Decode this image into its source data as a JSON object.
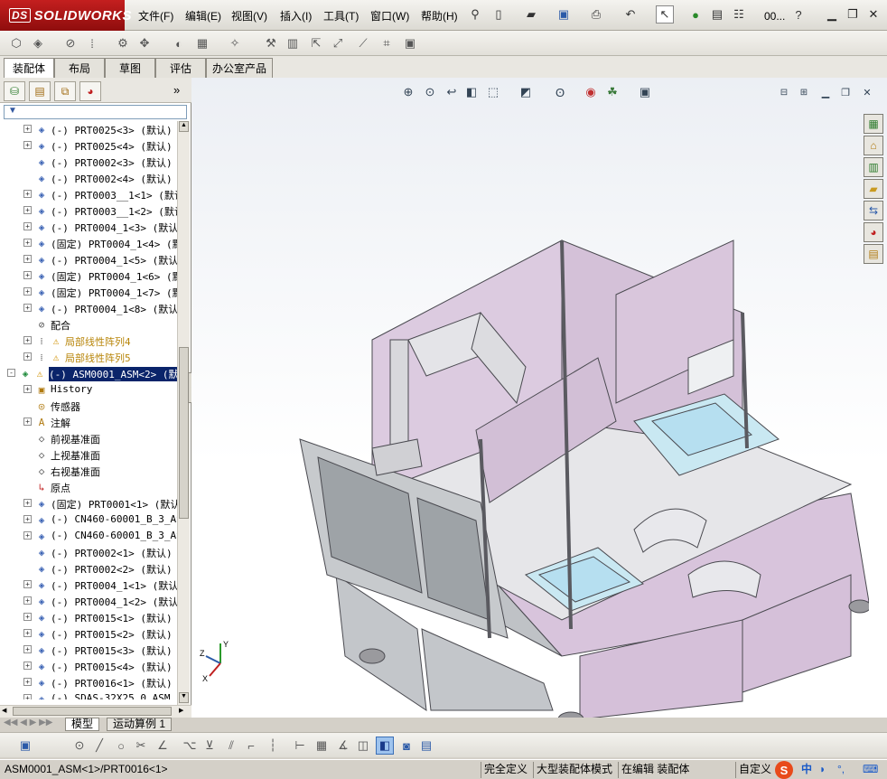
{
  "app": {
    "logo_text": "SOLIDWORKS",
    "logo_prefix": "DS"
  },
  "menu": [
    "文件(F)",
    "编辑(E)",
    "视图(V)",
    "插入(I)",
    "工具(T)",
    "窗口(W)",
    "帮助(H)"
  ],
  "quickbar": {
    "overflow_label": "00...",
    "help_label": "?"
  },
  "command_tabs": [
    {
      "label": "装配体",
      "active": true
    },
    {
      "label": "布局"
    },
    {
      "label": "草图"
    },
    {
      "label": "评估"
    },
    {
      "label": "办公室产品"
    }
  ],
  "left_pane": {
    "filter_symbol": "▼",
    "collapse_label": "»"
  },
  "tree": [
    {
      "exp": "+",
      "indent": 1,
      "icon": "part",
      "text": "(-) PRT0025<3> (默认)"
    },
    {
      "exp": "+",
      "indent": 1,
      "icon": "part",
      "text": "(-) PRT0025<4> (默认)"
    },
    {
      "exp": "",
      "indent": 1,
      "icon": "part",
      "text": "(-) PRT0002<3> (默认)"
    },
    {
      "exp": "",
      "indent": 1,
      "icon": "part",
      "text": "(-) PRT0002<4> (默认)"
    },
    {
      "exp": "+",
      "indent": 1,
      "icon": "part",
      "text": "(-) PRT0003__1<1> (默认"
    },
    {
      "exp": "+",
      "indent": 1,
      "icon": "part",
      "text": "(-) PRT0003__1<2> (默认"
    },
    {
      "exp": "+",
      "indent": 1,
      "icon": "part",
      "text": "(-) PRT0004_1<3> (默认"
    },
    {
      "exp": "+",
      "indent": 1,
      "icon": "part",
      "text": "(固定) PRT0004_1<4> (默"
    },
    {
      "exp": "+",
      "indent": 1,
      "icon": "part",
      "text": "(-) PRT0004_1<5> (默认"
    },
    {
      "exp": "+",
      "indent": 1,
      "icon": "part",
      "text": "(固定) PRT0004_1<6> (默"
    },
    {
      "exp": "+",
      "indent": 1,
      "icon": "part",
      "text": "(固定) PRT0004_1<7> (默"
    },
    {
      "exp": "+",
      "indent": 1,
      "icon": "part",
      "text": "(-) PRT0004_1<8> (默认"
    },
    {
      "exp": "",
      "indent": 1,
      "icon": "mate",
      "text": "配合"
    },
    {
      "exp": "+",
      "indent": 1,
      "icon": "pattern-warn",
      "text": "局部线性阵列4",
      "warn": true
    },
    {
      "exp": "+",
      "indent": 1,
      "icon": "pattern-warn",
      "text": "局部线性阵列5",
      "warn": true
    },
    {
      "exp": "-",
      "indent": 0,
      "icon": "asm-warn",
      "text": "(-) ASM0001_ASM<2> (默认",
      "selected": true
    },
    {
      "exp": "+",
      "indent": 1,
      "icon": "history",
      "text": "History"
    },
    {
      "exp": "",
      "indent": 1,
      "icon": "sensor",
      "text": "传感器"
    },
    {
      "exp": "+",
      "indent": 1,
      "icon": "annot",
      "text": "注解"
    },
    {
      "exp": "",
      "indent": 1,
      "icon": "plane",
      "text": "前视基准面"
    },
    {
      "exp": "",
      "indent": 1,
      "icon": "plane",
      "text": "上视基准面"
    },
    {
      "exp": "",
      "indent": 1,
      "icon": "plane",
      "text": "右视基准面"
    },
    {
      "exp": "",
      "indent": 1,
      "icon": "origin",
      "text": "原点"
    },
    {
      "exp": "+",
      "indent": 1,
      "icon": "part",
      "text": "(固定) PRT0001<1> (默认"
    },
    {
      "exp": "+",
      "indent": 1,
      "icon": "part",
      "text": "(-) CN460-60001_B_3_AS"
    },
    {
      "exp": "+",
      "indent": 1,
      "icon": "part",
      "text": "(-) CN460-60001_B_3_AS"
    },
    {
      "exp": "",
      "indent": 1,
      "icon": "part",
      "text": "(-) PRT0002<1> (默认)"
    },
    {
      "exp": "",
      "indent": 1,
      "icon": "part",
      "text": "(-) PRT0002<2> (默认)"
    },
    {
      "exp": "+",
      "indent": 1,
      "icon": "part",
      "text": "(-) PRT0004_1<1> (默认"
    },
    {
      "exp": "+",
      "indent": 1,
      "icon": "part",
      "text": "(-) PRT0004_1<2> (默认"
    },
    {
      "exp": "+",
      "indent": 1,
      "icon": "part",
      "text": "(-) PRT0015<1> (默认)"
    },
    {
      "exp": "+",
      "indent": 1,
      "icon": "part",
      "text": "(-) PRT0015<2> (默认)"
    },
    {
      "exp": "+",
      "indent": 1,
      "icon": "part",
      "text": "(-) PRT0015<3> (默认)"
    },
    {
      "exp": "+",
      "indent": 1,
      "icon": "part",
      "text": "(-) PRT0015<4> (默认)"
    },
    {
      "exp": "+",
      "indent": 1,
      "icon": "part",
      "text": "(-) PRT0016<1> (默认)"
    },
    {
      "exp": "+",
      "indent": 1,
      "icon": "part",
      "text": "(-) SDAS-32X25 0  ASM"
    }
  ],
  "bottom_tabs": [
    {
      "label": "模型",
      "active": true
    },
    {
      "label": "运动算例 1"
    }
  ],
  "status": {
    "path": "ASM0001_ASM<1>/PRT0016<1>",
    "definition": "完全定义",
    "mode": "大型装配体模式",
    "edit": "在编辑 装配体",
    "custom": "自定义",
    "ime": "中"
  },
  "triad": {
    "x": "X",
    "y": "Y",
    "z": "Z"
  },
  "colors": {
    "body_panel": "#d9c6dc",
    "frame": "#c9ccd0",
    "accent": "#c41f1f"
  }
}
